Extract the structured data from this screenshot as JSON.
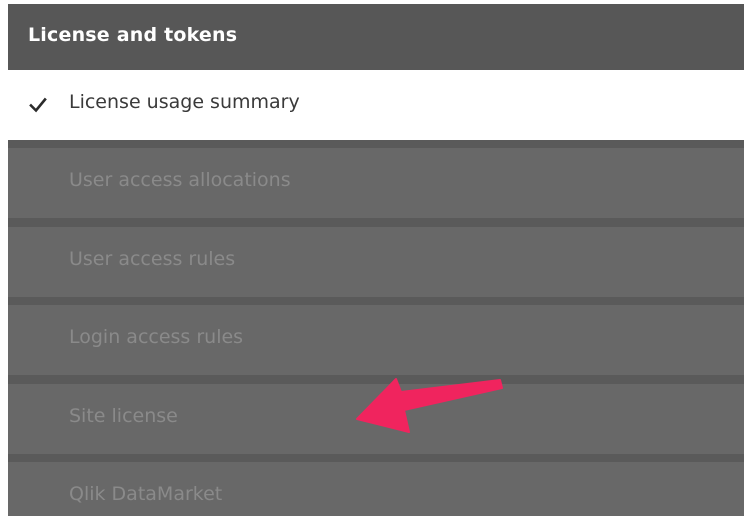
{
  "header": {
    "title": "License and tokens"
  },
  "menu": {
    "items": [
      {
        "label": "License usage summary",
        "active": true
      },
      {
        "label": "User access allocations",
        "active": false
      },
      {
        "label": "User access rules",
        "active": false
      },
      {
        "label": "Login access rules",
        "active": false
      },
      {
        "label": "Site license",
        "active": false
      },
      {
        "label": "Qlik DataMarket",
        "active": false
      }
    ]
  },
  "icons": {
    "active_marker": "check-icon",
    "annotation": "arrow-icon"
  },
  "colors": {
    "header_bg": "#575757",
    "item_bg": "#686868",
    "item_text": "#8a8a8a",
    "active_bg": "#ffffff",
    "active_text": "#3a3a3a",
    "annotation": "#f0245e"
  }
}
